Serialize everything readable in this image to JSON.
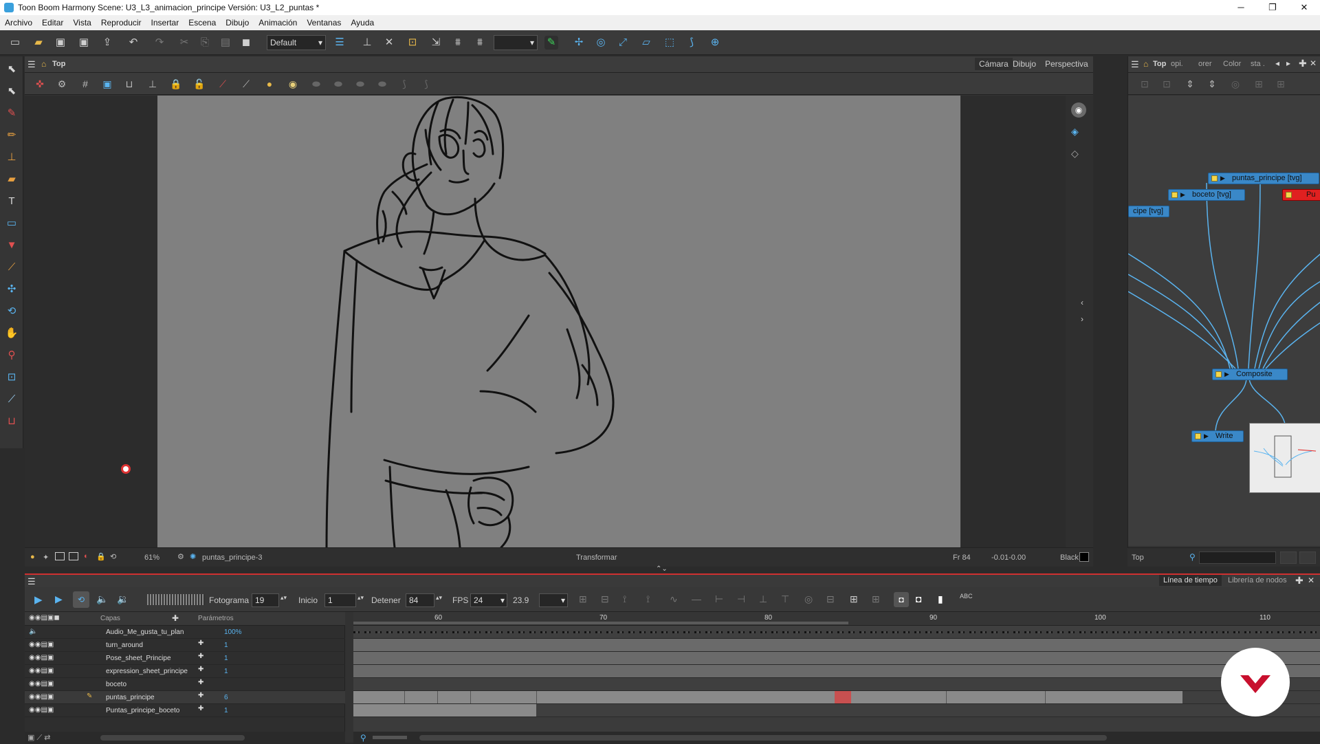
{
  "window": {
    "title": "Toon Boom Harmony Scene: U3_L3_animacion_principe Versión: U3_L2_puntas *",
    "minimize": "─",
    "maximize": "❐",
    "close": "✕"
  },
  "menu": [
    "Archivo",
    "Editar",
    "Vista",
    "Reproducir",
    "Insertar",
    "Escena",
    "Dibujo",
    "Animación",
    "Ventanas",
    "Ayuda"
  ],
  "toolbar": {
    "workspace": "Default"
  },
  "camera_view": {
    "view_label": "Top",
    "tabs": [
      "Cámara",
      "Dibujo",
      "Perspectiva"
    ],
    "zoom": "61%",
    "current_drawing": "puntas_principe-3",
    "tool_name": "Transformar",
    "frame": "Fr 84",
    "coords": "-0.01-0.00",
    "color_name": "Black"
  },
  "node_view": {
    "view_label": "Top",
    "tabs": [
      "opi.",
      "orer",
      "Color",
      "sta ."
    ],
    "nodes": {
      "puntas": "puntas_principe [tvg]",
      "boceto": "boceto [tvg]",
      "cipe": "cipe [tvg]",
      "composite": "Composite",
      "write": "Write",
      "red": "Pu"
    },
    "status_label": "Top"
  },
  "timeline": {
    "tabs": [
      "Línea de tiempo",
      "Librería de nodos"
    ],
    "fotograma_label": "Fotograma",
    "fotograma": "19",
    "inicio_label": "Inicio",
    "inicio": "1",
    "detener_label": "Detener",
    "detener": "84",
    "fps_label": "FPS",
    "fps": "24",
    "fps_actual": "23.9",
    "layers_header": "Capas",
    "params_header": "Parámetros",
    "ruler": [
      "60",
      "70",
      "80",
      "90",
      "100",
      "110"
    ],
    "layers": [
      {
        "name": "Audio_Me_gusta_tu_plan",
        "param": "100%"
      },
      {
        "name": "turn_around",
        "param": "1"
      },
      {
        "name": "Pose_sheet_Principe",
        "param": "1"
      },
      {
        "name": "expression_sheet_principe",
        "param": "1"
      },
      {
        "name": "boceto",
        "param": ""
      },
      {
        "name": "puntas_principe",
        "param": "6"
      },
      {
        "name": "Puntas_principe_boceto",
        "param": "1"
      }
    ]
  },
  "colors": {
    "canvas_bg": "#808080",
    "node_blue": "#3a88c8",
    "connection": "#5ab4f0",
    "timeline_accent": "#d03030",
    "selected_frame": "#c85050"
  }
}
